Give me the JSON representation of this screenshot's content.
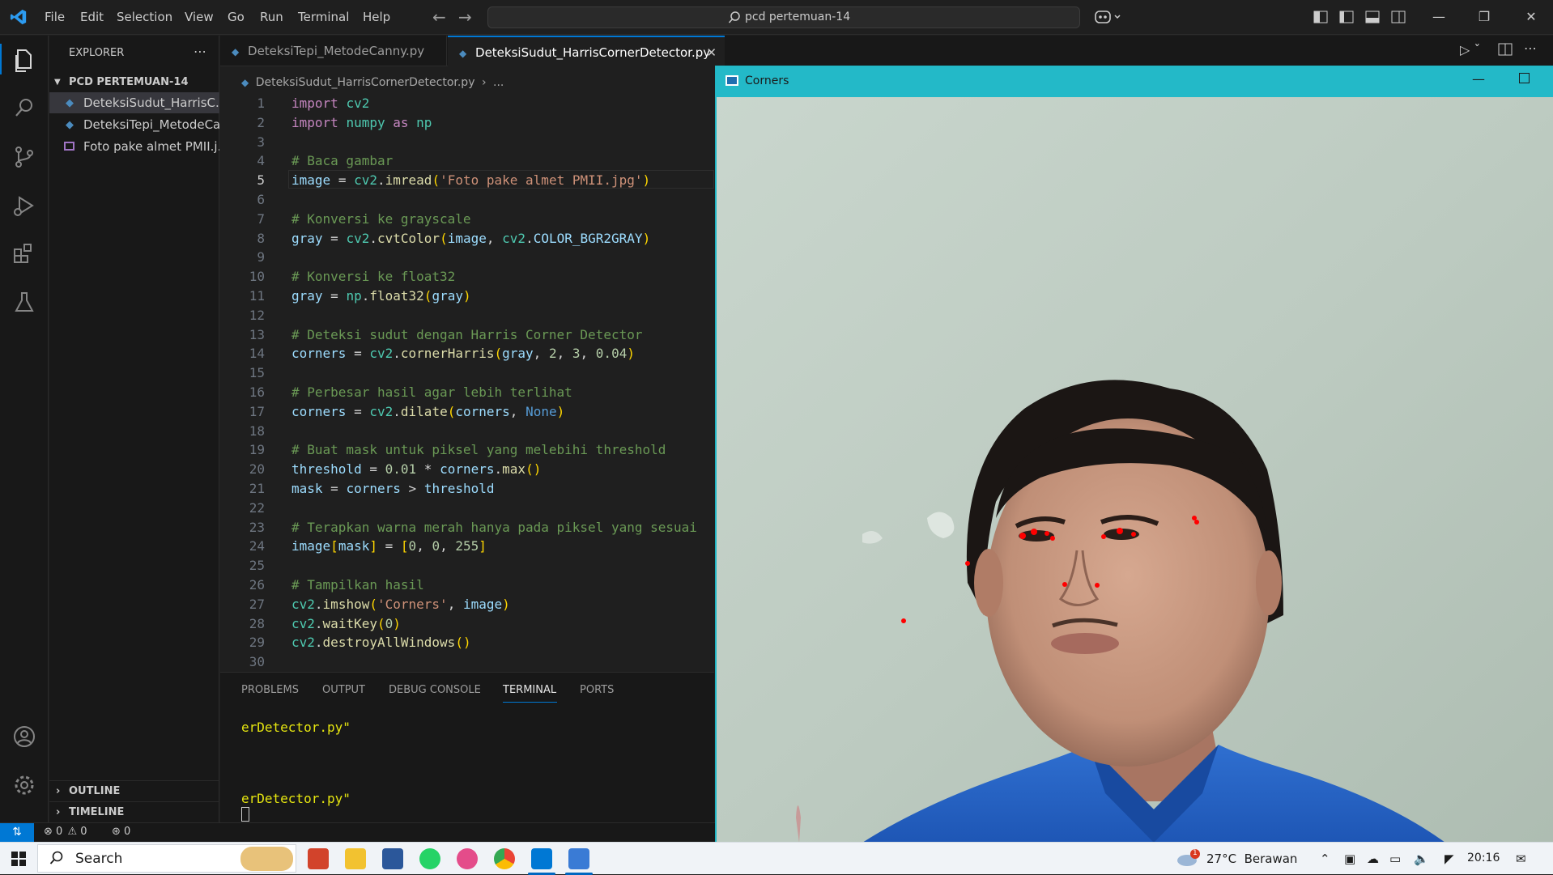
{
  "titlebar": {
    "menu": [
      "File",
      "Edit",
      "Selection",
      "View",
      "Go",
      "Run",
      "Terminal",
      "Help"
    ],
    "search_text": "pcd pertemuan-14"
  },
  "sidebar": {
    "header": "EXPLORER",
    "folder": "PCD PERTEMUAN-14",
    "files": [
      {
        "name": "DeteksiSudut_HarrisC...",
        "type": "python",
        "selected": true
      },
      {
        "name": "DeteksiTepi_MetodeCa...",
        "type": "python",
        "selected": false
      },
      {
        "name": "Foto pake almet PMII.j...",
        "type": "image",
        "selected": false
      }
    ],
    "outline_label": "OUTLINE",
    "timeline_label": "TIMELINE"
  },
  "tabs": [
    {
      "label": "DeteksiTepi_MetodeCanny.py",
      "active": false
    },
    {
      "label": "DeteksiSudut_HarrisCornerDetector.py",
      "active": true
    }
  ],
  "breadcrumb": {
    "file": "DeteksiSudut_HarrisCornerDetector.py",
    "rest": "..."
  },
  "code_lines": [
    {
      "n": "1"
    },
    {
      "n": "2"
    },
    {
      "n": "3"
    },
    {
      "n": "4"
    },
    {
      "n": "5"
    },
    {
      "n": "6"
    },
    {
      "n": "7"
    },
    {
      "n": "8"
    },
    {
      "n": "9"
    },
    {
      "n": "10"
    },
    {
      "n": "11"
    },
    {
      "n": "12"
    },
    {
      "n": "13"
    },
    {
      "n": "14"
    },
    {
      "n": "15"
    },
    {
      "n": "16"
    },
    {
      "n": "17"
    },
    {
      "n": "18"
    },
    {
      "n": "19"
    },
    {
      "n": "20"
    },
    {
      "n": "21"
    },
    {
      "n": "22"
    },
    {
      "n": "23"
    },
    {
      "n": "24"
    },
    {
      "n": "25"
    },
    {
      "n": "26"
    },
    {
      "n": "27"
    },
    {
      "n": "28"
    },
    {
      "n": "29"
    },
    {
      "n": "30"
    }
  ],
  "panel": {
    "tabs": [
      "PROBLEMS",
      "OUTPUT",
      "DEBUG CONSOLE",
      "TERMINAL",
      "PORTS"
    ],
    "active_tab": "TERMINAL",
    "terminal_lines": [
      "erDetector.py\"",
      "erDetector.py\""
    ]
  },
  "statusbar": {
    "errors": "0",
    "warnings": "0",
    "ports": "0"
  },
  "cv_window": {
    "title": "Corners"
  },
  "taskbar": {
    "search": "Search",
    "weather": "27°C  Berawan",
    "weather_badge": "1",
    "time": "20:16"
  },
  "colors": {
    "accent": "#0078d4",
    "cv_title": "#23b9c8",
    "corner_marks": "#ff0000"
  }
}
